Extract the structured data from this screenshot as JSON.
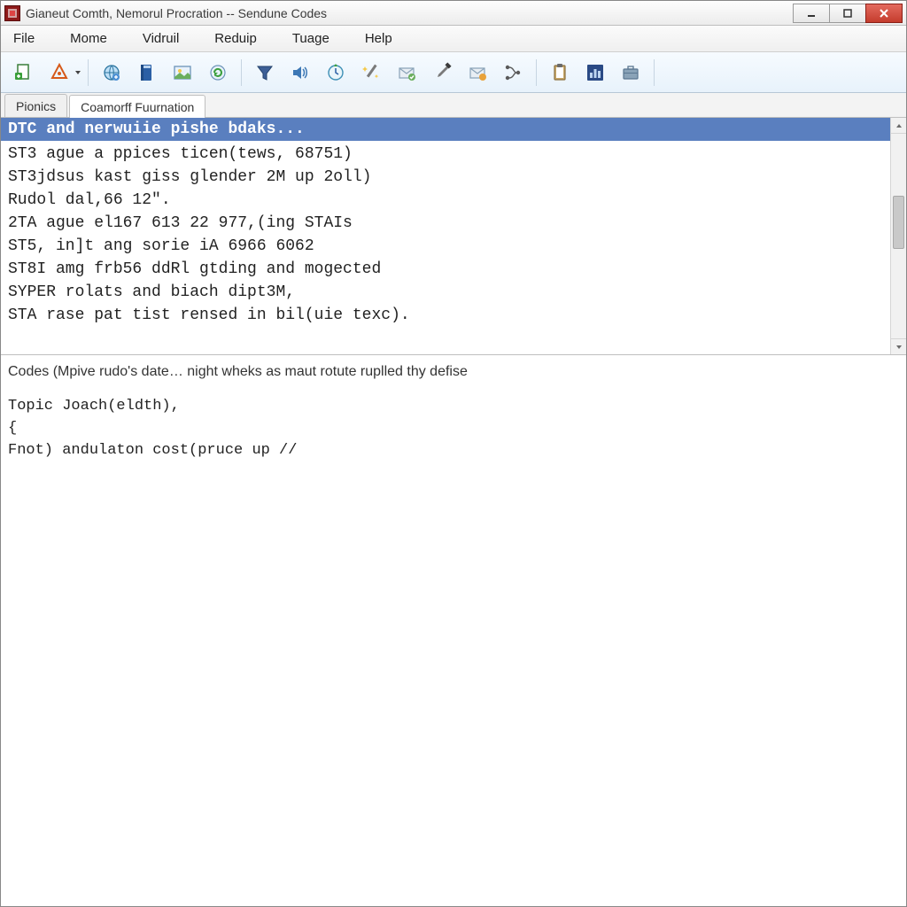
{
  "window": {
    "title": "Gianeut Comth, Nemorul Procration -- Sendune Codes"
  },
  "menu": {
    "items": [
      "File",
      "Mome",
      "Vidruil",
      "Reduip",
      "Tuage",
      "Help"
    ]
  },
  "toolbar": {
    "icons": [
      "new-doc-icon",
      "shape-icon",
      "dropdown-icon",
      "sep",
      "globe-icon",
      "book-icon",
      "picture-icon",
      "arrow-refresh-icon",
      "sep",
      "funnel-icon",
      "speaker-icon",
      "clock-icon",
      "wand-icon",
      "mail-clean-icon",
      "brush-icon",
      "mail-flag-icon",
      "branch-icon",
      "sep",
      "clipboard-icon",
      "chart-icon",
      "briefcase-icon",
      "sep"
    ]
  },
  "tabs": {
    "items": [
      {
        "label": "Pionics",
        "active": false
      },
      {
        "label": "Coamorff Fuurnation",
        "active": true
      }
    ]
  },
  "upper": {
    "header": "DTC and nerwuiie pishe bdaks...",
    "lines": [
      "ST3 ague a ppices ticen(tews, 68751)",
      "ST3jdsus kast giss glender 2M up 2oll)",
      "Rudol dal,66 12\".",
      "",
      "2TA ague el167 613 22 977,(ing STAIs",
      "ST5, in]t ang sorie iA 6966 6062",
      "ST8I amg frb56 ddRl gtding and mogected",
      "SYPER rolats and biach dipt3M,",
      "STA rase pat tist rensed in bil(uie texc)."
    ]
  },
  "lower": {
    "status": "Codes (Mpive rudo's date… night wheks as maut rotute ruplled thy defise",
    "lines": [
      "Topic Joach(eldth),",
      "{",
      "Fnot) andulaton cost(pruce up //"
    ]
  },
  "colors": {
    "header_blue": "#5a7fbf",
    "close_red": "#c43c2d"
  }
}
